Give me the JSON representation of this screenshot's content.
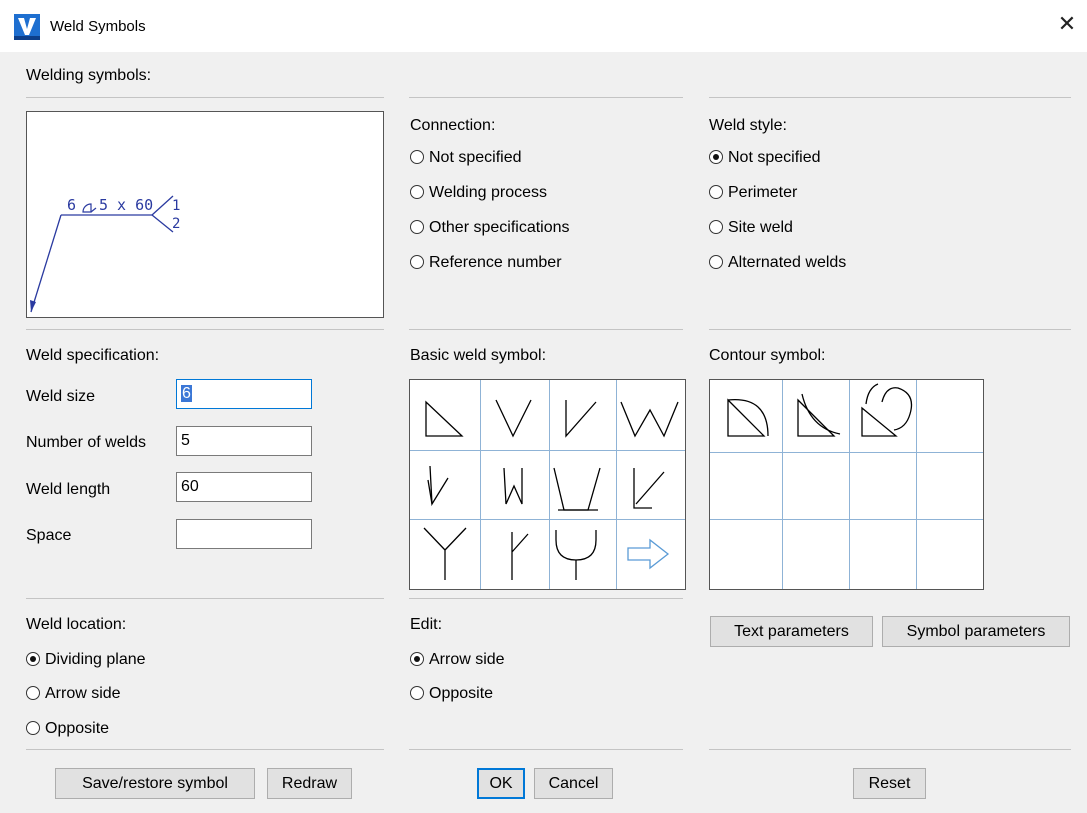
{
  "window": {
    "title": "Weld Symbols",
    "icon": "vertex-logo-icon",
    "close_label": "✕"
  },
  "welding_symbols": {
    "label": "Welding symbols:",
    "preview": {
      "size_text": "6",
      "length_text": "5 x 60",
      "ref_top": "1",
      "ref_bottom": "2"
    }
  },
  "connection": {
    "label": "Connection:",
    "options": [
      "Not specified",
      "Welding process",
      "Other specifications",
      "Reference number"
    ],
    "selected": null
  },
  "weld_style": {
    "label": "Weld style:",
    "options": [
      "Not specified",
      "Perimeter",
      "Site weld",
      "Alternated welds"
    ],
    "selected": "Not specified"
  },
  "weld_specification": {
    "label": "Weld specification:",
    "fields": [
      {
        "label": "Weld size",
        "value": "6"
      },
      {
        "label": "Number of welds",
        "value": "5"
      },
      {
        "label": "Weld length",
        "value": "60"
      },
      {
        "label": "Space",
        "value": ""
      }
    ]
  },
  "basic_weld_symbol": {
    "label": "Basic weld symbol:",
    "symbols": [
      "fillet-weld-icon",
      "v-butt-weld-icon",
      "bevel-butt-weld-icon",
      "double-v-weld-icon",
      "steep-v-weld-icon",
      "steep-bevel-weld-icon",
      "v-weld-broad-root-icon",
      "bevel-weld-broad-root-icon",
      "y-weld-icon",
      "j-bevel-weld-icon",
      "u-weld-icon",
      "next-arrow-icon"
    ]
  },
  "contour_symbol": {
    "label": "Contour symbol:",
    "symbols": [
      "convex-contour-icon",
      "concave-contour-icon",
      "blended-contour-icon"
    ]
  },
  "weld_location": {
    "label": "Weld location:",
    "options": [
      "Dividing plane",
      "Arrow side",
      "Opposite"
    ],
    "selected": "Dividing plane"
  },
  "edit": {
    "label": "Edit:",
    "options": [
      "Arrow side",
      "Opposite"
    ],
    "selected": "Arrow side"
  },
  "buttons": {
    "text_parameters": "Text parameters",
    "symbol_parameters": "Symbol parameters",
    "save_restore": "Save/restore symbol",
    "redraw": "Redraw",
    "ok": "OK",
    "cancel": "Cancel",
    "reset": "Reset"
  },
  "colors": {
    "accent": "#0078d7",
    "symbol_blue": "#2a3aa0",
    "grid_line": "#8fb3d6"
  }
}
